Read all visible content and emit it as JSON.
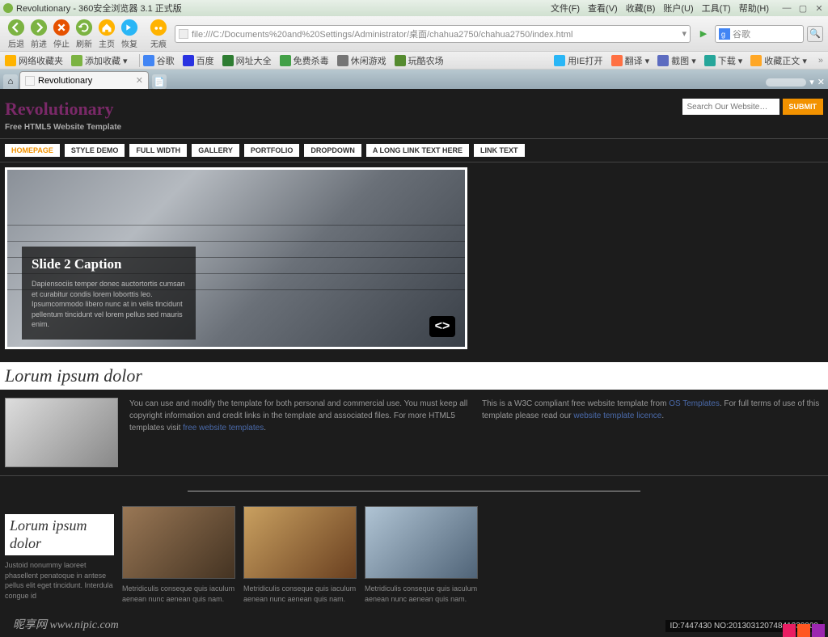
{
  "browser": {
    "title": "Revolutionary - 360安全浏览器 3.1 正式版",
    "menu": [
      "文件(F)",
      "查看(V)",
      "收藏(B)",
      "账户(U)",
      "工具(T)",
      "帮助(H)"
    ],
    "nav_labels": {
      "back": "后退",
      "forward": "前进",
      "stop": "停止",
      "refresh": "刷新",
      "home": "主页",
      "restore": "恢复",
      "none": "无痕"
    },
    "url": "file:///C:/Documents%20and%20Settings/Administrator/桌面/chahua2750/chahua2750/index.html",
    "search_placeholder": "谷歌",
    "bookmarks_left": [
      "网络收藏夹",
      "添加收藏 ▾",
      "谷歌",
      "百度",
      "网址大全",
      "免费杀毒",
      "休闲游戏",
      "玩酷农场"
    ],
    "bookmarks_right": [
      "用IE打开",
      "翻译 ▾",
      "截图 ▾",
      "下载 ▾",
      "收藏正文 ▾"
    ],
    "tab_label": "Revolutionary"
  },
  "site": {
    "title": "Revolutionary",
    "subtitle": "Free HTML5 Website Template",
    "search_placeholder": "Search Our Website…",
    "submit": "SUBMIT",
    "nav": [
      "HOMEPAGE",
      "STYLE DEMO",
      "FULL WIDTH",
      "GALLERY",
      "PORTFOLIO",
      "DROPDOWN",
      "A LONG LINK TEXT HERE",
      "LINK TEXT"
    ]
  },
  "slider": {
    "caption_title": "Slide 2 Caption",
    "caption_text": "Dapiensociis temper donec auctortortis cumsan et curabitur condis lorem loborttis leo. Ipsumcommodo libero nunc at in velis tincidunt pellentum tincidunt vel lorem pellus sed mauris enim."
  },
  "section1": {
    "heading": "Lorum ipsum dolor",
    "text1_a": "You can use and modify the template for both personal and commercial use. You must keep all copyright information and credit links in the template and associated files. For more HTML5 templates visit ",
    "link1": "free website templates",
    "text2_a": "This is a W3C compliant free website template from ",
    "link2": "OS Templates",
    "text2_b": ". For full terms of use of this template please read our ",
    "link3": "website template licence"
  },
  "section2": {
    "heading": "Lorum ipsum dolor",
    "left_text": "Justoid nonummy laoreet phasellent penatoque in antese pellus elit eget tincidunt. Interdula congue id",
    "card_text": "Metridiculis conseque quis iaculum aenean nunc aenean quis nam."
  },
  "watermark": {
    "bl": "昵享网  www.nipic.com",
    "br": "ID:7447430 NO:20130312074841230000"
  }
}
